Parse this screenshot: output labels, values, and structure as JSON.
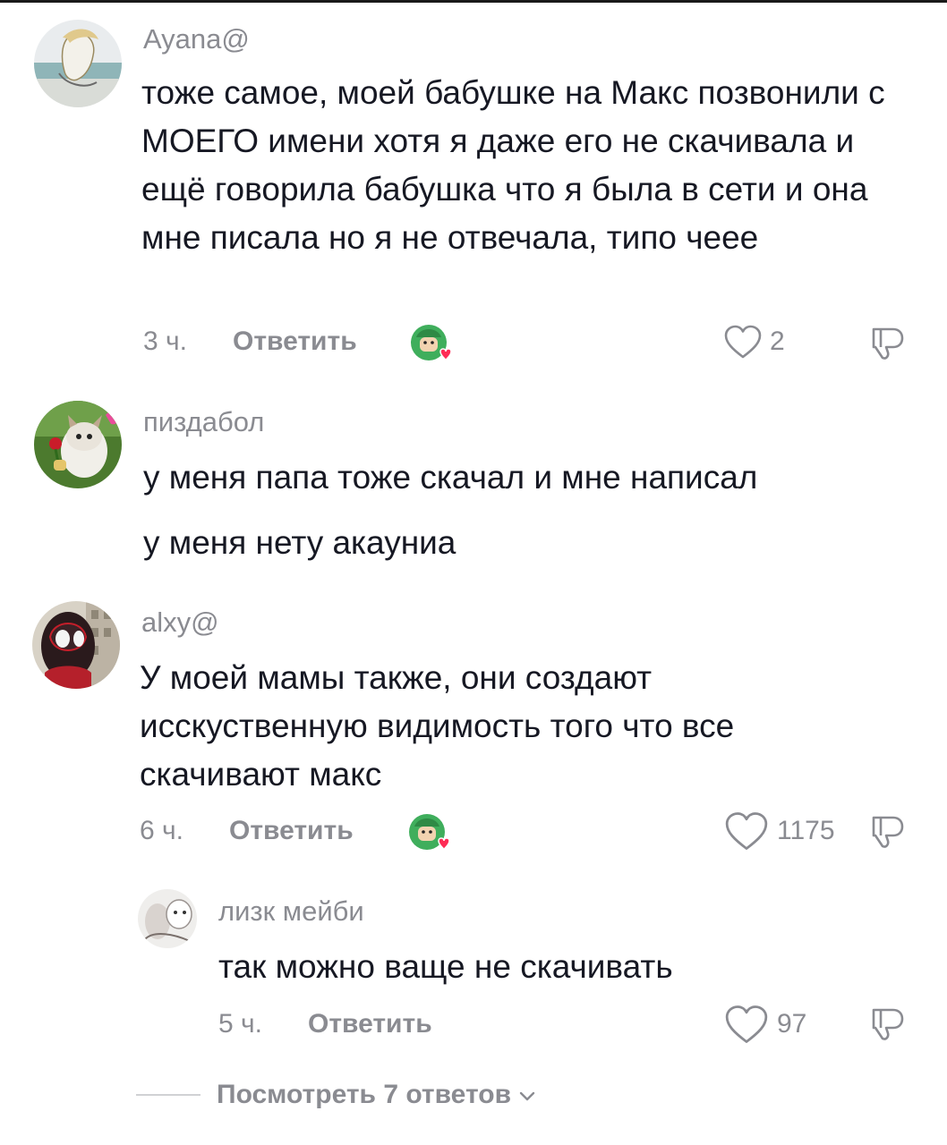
{
  "comments": [
    {
      "avatar": "avatar-ayana",
      "username": "Ayana@",
      "text": "тоже самое, моей бабушке на Макс позвонили с МОЕГО имени хотя я даже его не скачивала и ещё говорила бабушка что я была в сети и она мне писала но я не отвечала, типо чеее",
      "time": "3 ч.",
      "reply_label": "Ответить",
      "likes": "2"
    },
    {
      "avatar": "avatar-pizdabol",
      "username": "пиздабол",
      "text": "у меня папа тоже скачал и мне написал",
      "extra_text": "у меня нету акауниа"
    },
    {
      "avatar": "avatar-alxy",
      "username": "alxy@",
      "text": "У моей мамы также, они создают исскуственную видимость того что все скачивают макс",
      "time": "6 ч.",
      "reply_label": "Ответить",
      "likes": "1175"
    }
  ],
  "reply": {
    "avatar": "avatar-lizk",
    "username": "лизк мейби",
    "text": "так можно ваще не скачивать",
    "time": "5 ч.",
    "reply_label": "Ответить",
    "likes": "97"
  },
  "view_replies_label": "Посмотреть 7 ответов",
  "colors": {
    "text": "#161823",
    "muted": "#8a8b91",
    "heart_badge": "#fe2c55"
  },
  "icons": [
    "heart-outline-icon",
    "dislike-icon",
    "creator-liked-icon",
    "chevron-down-icon"
  ]
}
